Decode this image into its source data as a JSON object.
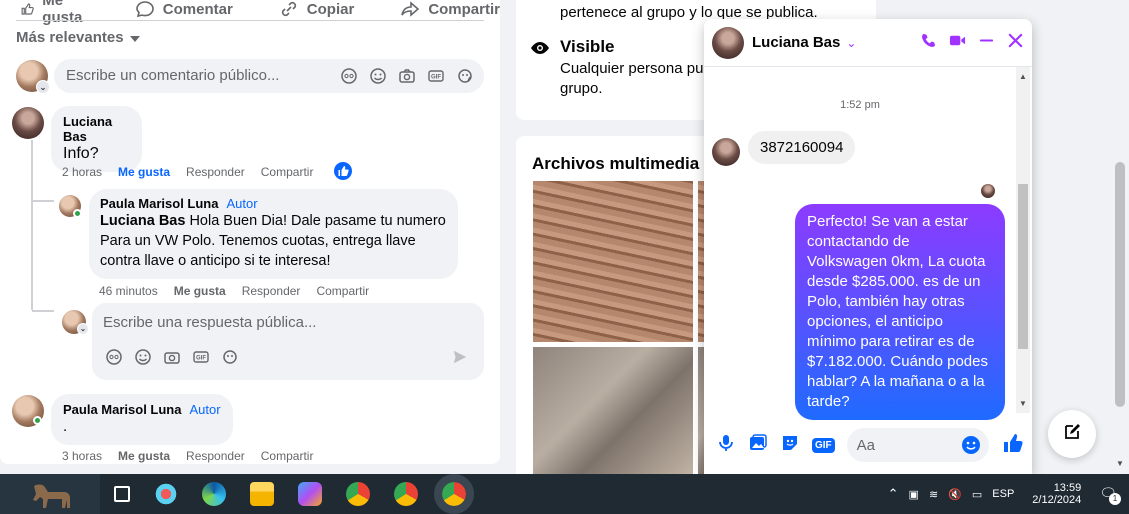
{
  "post": {
    "actions": {
      "like": "Me gusta",
      "comment": "Comentar",
      "copy": "Copiar",
      "share": "Compartir"
    },
    "sort_label": "Más relevantes",
    "comment_placeholder": "Escribe un comentario público...",
    "reply_placeholder": "Escribe una respuesta pública...",
    "comments": [
      {
        "name": "Luciana Bas",
        "text": "Info?",
        "time": "2 horas",
        "like": "Me gusta",
        "reply": "Responder",
        "share": "Compartir"
      },
      {
        "name": "Paula Marisol Luna",
        "badge": "Autor",
        "mention": "Luciana Bas",
        "text": " Hola Buen Dia! Dale pasame tu numero Para un VW Polo. Tenemos cuotas, entrega llave contra llave o anticipo si te interesa!",
        "time": "46 minutos",
        "like": "Me gusta",
        "reply": "Responder",
        "share": "Compartir"
      },
      {
        "name": "Paula Marisol Luna",
        "badge": "Autor",
        "text": ".",
        "time": "3 horas",
        "like": "Me gusta",
        "reply": "Responder",
        "share": "Compartir"
      }
    ]
  },
  "group_info": {
    "line_top": "pertenece al grupo y lo que se publica.",
    "visible_title": "Visible",
    "visible_desc": "Cualquier persona pue",
    "visible_desc2": "grupo."
  },
  "media": {
    "title": "Archivos multimedia re"
  },
  "chat": {
    "name": "Luciana Bas",
    "timestamp": "1:52 pm",
    "incoming": "3872160094",
    "outgoing": "Perfecto!  Se van a estar contactando de Volkswagen 0km, La cuota desde $285.000. es de un Polo, también hay otras opciones, el anticipo mínimo para retirar es de $7.182.000. Cuándo podes hablar? A la mañana o a la tarde?",
    "input_placeholder": "Aa",
    "gif_label": "GIF"
  },
  "taskbar": {
    "language": "ESP",
    "time": "13:59",
    "date": "2/12/2024",
    "notification_count": "1"
  },
  "colors": {
    "accent": "#0866ff",
    "messenger_purple": "#a033ff",
    "taskbar": "#1f2a33"
  }
}
